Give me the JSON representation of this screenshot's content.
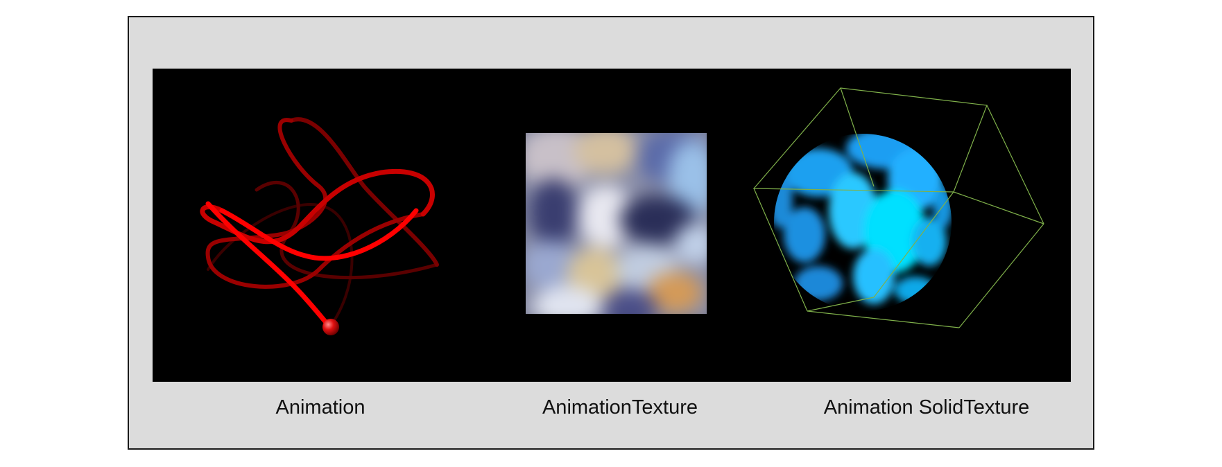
{
  "captions": {
    "animation": "Animation",
    "animation_texture": "AnimationTexture",
    "animation_solid_texture": "Animation SolidTexture"
  },
  "colors": {
    "frame_background": "#dcdcdc",
    "stage_background": "#000000",
    "curve": "#ff0000",
    "sphere_texture": "#1ea8ff",
    "cube_edges": "#7fb04a"
  }
}
